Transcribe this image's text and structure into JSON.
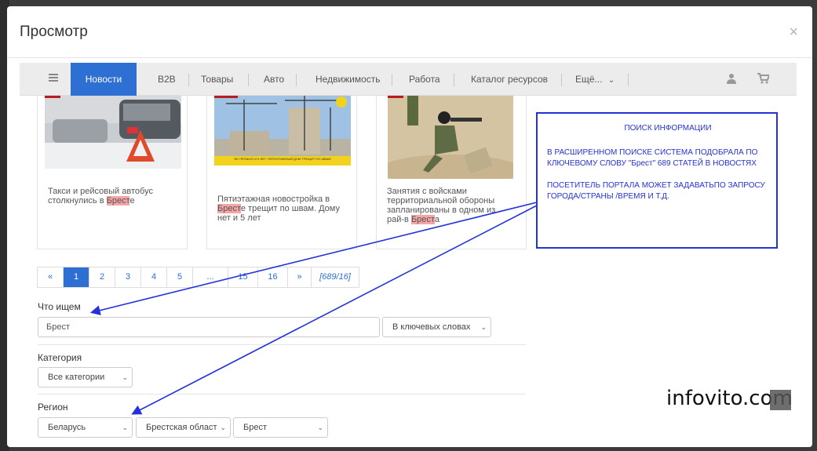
{
  "modal": {
    "title": "Просмотр",
    "close_glyph": "×"
  },
  "nav": {
    "items": [
      "Новости",
      "B2B",
      "Товары",
      "Авто",
      "Недвижимость",
      "Работа",
      "Каталог ресурсов",
      "Ещё..."
    ],
    "more_chevron": "⌄"
  },
  "cards": [
    {
      "text_before": "Такси и рейсовый автобус столкнулись в ",
      "highlight": "Брест",
      "text_after": "е"
    },
    {
      "text_before": "Пятиэтажная новостройка в ",
      "highlight": "Брест",
      "text_after": "е трещит по швам. Дому нет и 5 лет",
      "image_caption": "НЕ ПРОШЛО И 5 ЛЕТ. ПЯТИЭТАЖНЫЙ ДОМ ТРЕЩИТ ПО ШВАМ"
    },
    {
      "text_before": "Занятия с войсками территориальной обороны запланированы в одном из рай-в ",
      "highlight": "Брест",
      "text_after": "а"
    }
  ],
  "pagination": [
    "«",
    "1",
    "2",
    "3",
    "4",
    "5",
    "...",
    "15",
    "16",
    "»",
    "[689/16]"
  ],
  "search": {
    "label": "Что ищем",
    "value": "Брест",
    "mode": "В ключевых словах"
  },
  "category": {
    "label": "Категория",
    "value": "Все категории"
  },
  "region": {
    "label": "Регион",
    "country": "Беларусь",
    "oblast": "Брестская област",
    "city": "Брест"
  },
  "infobox": {
    "title": "ПОИСК ИНФОРМАЦИИ",
    "line1": "В РАСШИРЕННОМ ПОИСКЕ  СИСТЕМА ПОДОБРАЛА ПО",
    "line2": "КЛЮЧЕВОМУ СЛОВУ  \"Брест\"  689 СТАТЕЙ В НОВОСТЯХ",
    "line3": "ПОСЕТИТЕЛЬ ПОРТАЛА МОЖЕТ ЗАДАВАТЬПО ЗАПРОСУ",
    "line4": "ГОРОДА/СТРАНЫ /ВРЕМЯ И Т.Д."
  },
  "watermark": "infovito.com",
  "colors": {
    "accent": "#2d6fd2",
    "annotation": "#2432d8",
    "highlight": "#f4a6a6"
  }
}
